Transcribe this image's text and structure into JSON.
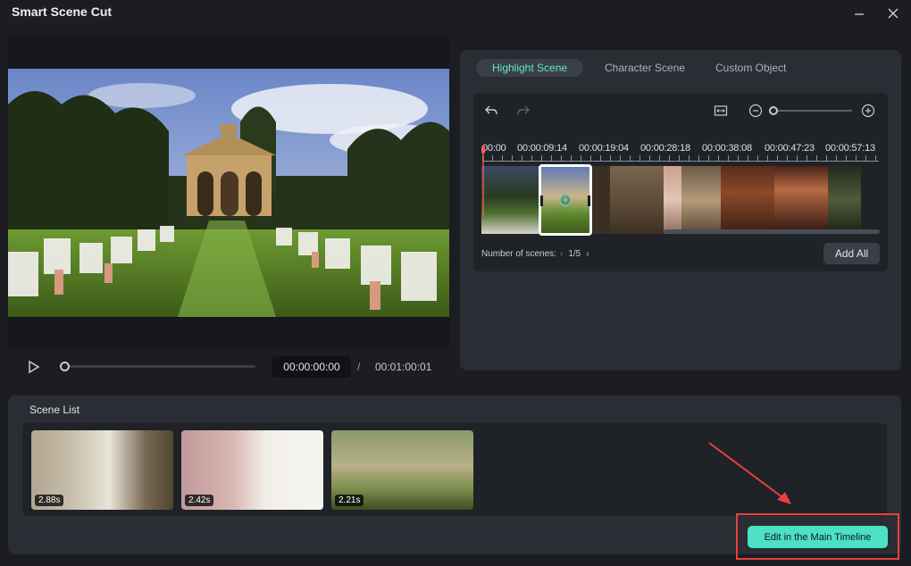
{
  "window": {
    "title": "Smart Scene Cut"
  },
  "player": {
    "current_time": "00:00:00:00",
    "separator": "/",
    "total_time": "00:01:00:01"
  },
  "tabs": [
    {
      "label": "Highlight Scene"
    },
    {
      "label": "Character Scene"
    },
    {
      "label": "Custom Object"
    }
  ],
  "timeline": {
    "ruler": [
      "00:00",
      "00:00:09:14",
      "00:00:19:04",
      "00:00:28:18",
      "00:00:38:08",
      "00:00:47:23",
      "00:00:57:13"
    ],
    "scenes_label": "Number of scenes:",
    "page": "1/5",
    "add_all_label": "Add All"
  },
  "scene_list": {
    "title": "Scene List",
    "items": [
      {
        "duration": "2.88s"
      },
      {
        "duration": "2.42s"
      },
      {
        "duration": "2.21s"
      }
    ]
  },
  "actions": {
    "edit_main_label": "Edit in the Main Timeline"
  },
  "colors": {
    "accent": "#4de0c4",
    "highlight_box": "#e8413f",
    "playhead": "#ff5a5a"
  }
}
